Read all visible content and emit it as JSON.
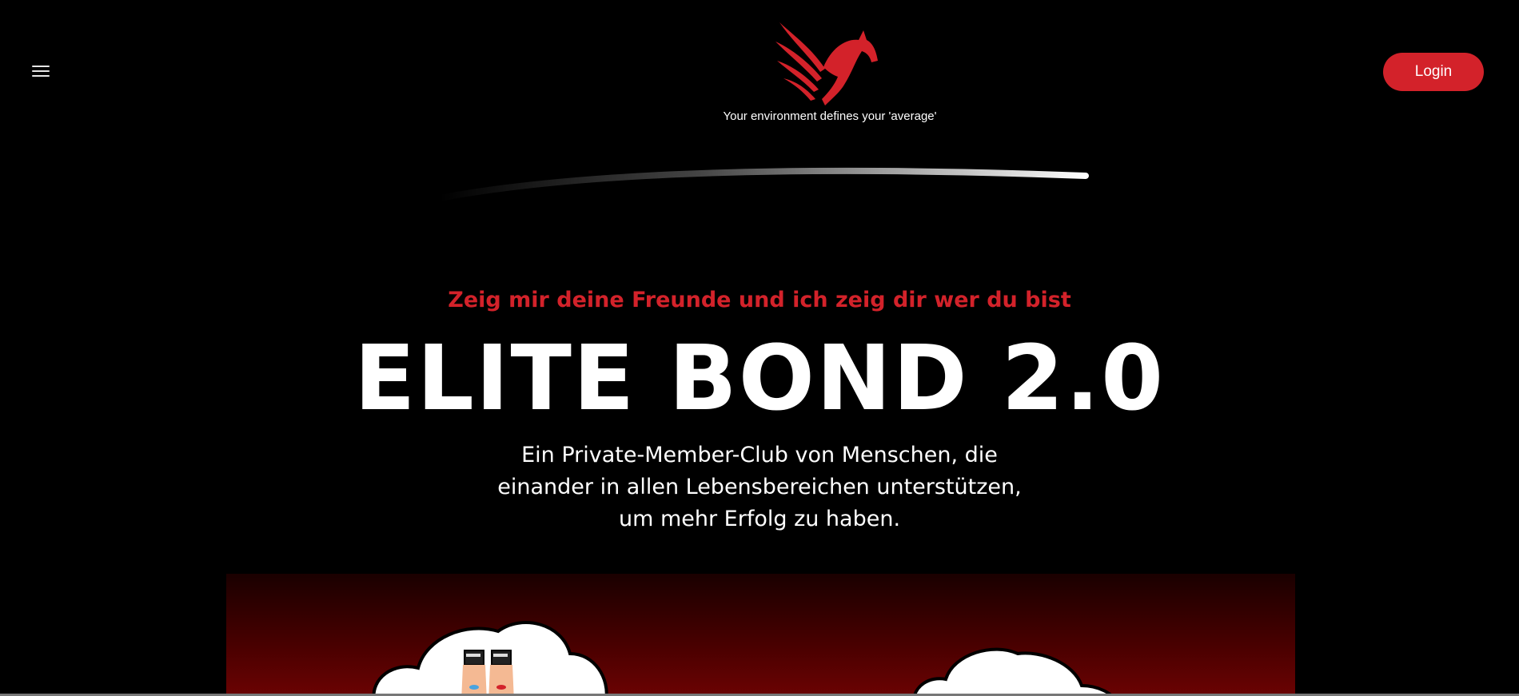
{
  "header": {
    "tagline": "Your environment defines your 'average'",
    "login_label": "Login",
    "menu_icon": "hamburger-menu-icon",
    "logo_icon": "red-pegasus-logo"
  },
  "hero": {
    "kicker": "Zeig mir deine Freunde und ich zeig dir wer du bist",
    "title": "ELITE BOND 2.0",
    "subtitle_lines": [
      "Ein Private-Member-Club von Menschen, die",
      "einander in allen Lebensbereichen unterstützen,",
      "um mehr Erfolg zu haben."
    ]
  },
  "colors": {
    "accent": "#d3222a",
    "background": "#000000",
    "text": "#ffffff"
  }
}
